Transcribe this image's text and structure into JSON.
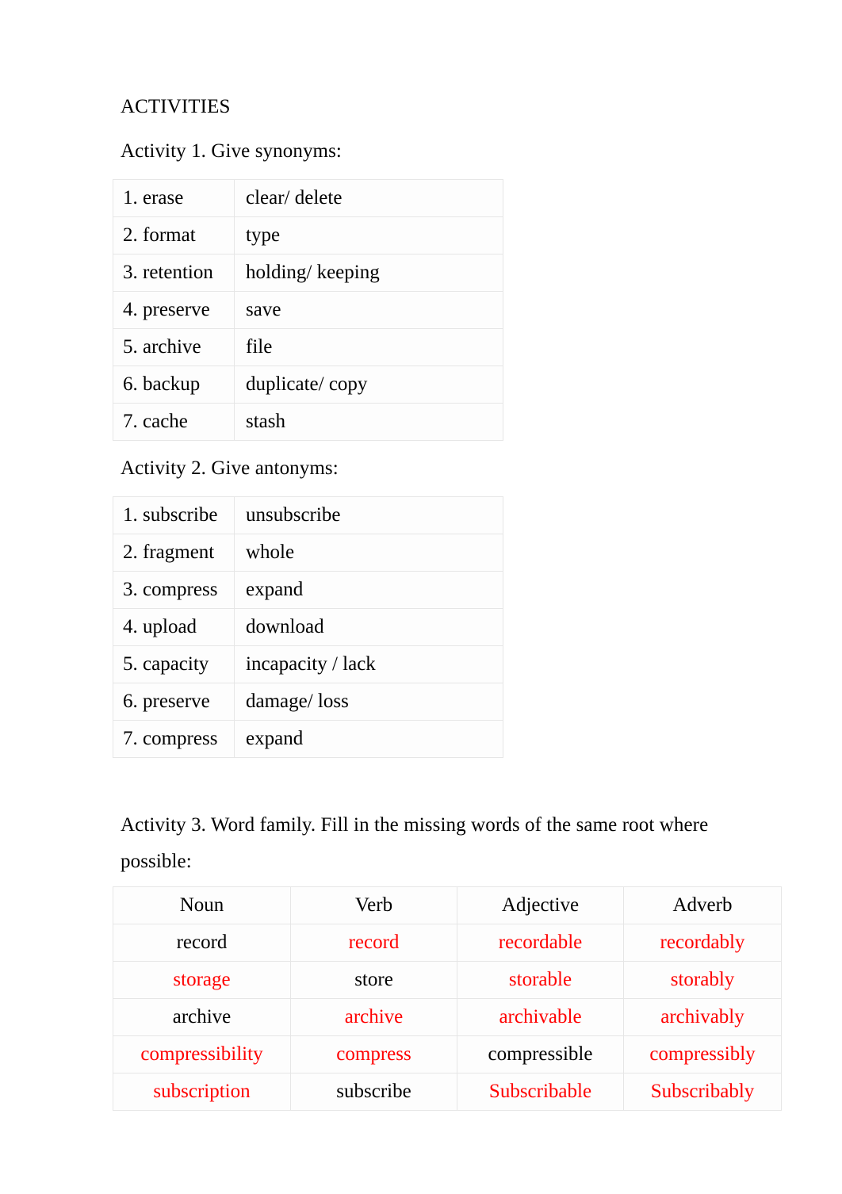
{
  "document": {
    "heading": "ACTIVITIES",
    "colors": {
      "text": "#000000",
      "filled_answer": "#ff0000",
      "table_border": "#e6e6e6",
      "page_background": "#ffffff"
    }
  },
  "activity1": {
    "label": "Activity 1. Give synonyms:",
    "rows": [
      {
        "term": "1. erase",
        "answer": "clear/ delete"
      },
      {
        "term": "2. format",
        "answer": "type"
      },
      {
        "term": "3. retention",
        "answer": "holding/ keeping"
      },
      {
        "term": "4. preserve",
        "answer": "save"
      },
      {
        "term": "5. archive",
        "answer": "file"
      },
      {
        "term": "6. backup",
        "answer": "duplicate/ copy"
      },
      {
        "term": "7. cache",
        "answer": "stash"
      }
    ]
  },
  "activity2": {
    "label": "Activity 2. Give antonyms:",
    "rows": [
      {
        "term": "1. subscribe",
        "answer": "unsubscribe"
      },
      {
        "term": "2. fragment",
        "answer": "whole"
      },
      {
        "term": "3. compress",
        "answer": "expand"
      },
      {
        "term": "4. upload",
        "answer": "download"
      },
      {
        "term": "5. capacity",
        "answer": "incapacity / lack"
      },
      {
        "term": "6. preserve",
        "answer": "damage/ loss"
      },
      {
        "term": "7. compress",
        "answer": "expand"
      }
    ]
  },
  "activity3": {
    "label": "Activity 3. Word family. Fill in the missing words of the same root where possible:",
    "headers": [
      "Noun",
      "Verb",
      "Adjective",
      "Adverb"
    ],
    "rows": [
      {
        "noun": {
          "text": "record",
          "color": "black"
        },
        "verb": {
          "text": "record",
          "color": "red"
        },
        "adjective": {
          "text": "recordable",
          "color": "red"
        },
        "adverb": {
          "text": "recordably",
          "color": "red"
        }
      },
      {
        "noun": {
          "text": "storage",
          "color": "red"
        },
        "verb": {
          "text": "store",
          "color": "black"
        },
        "adjective": {
          "text": "storable",
          "color": "red"
        },
        "adverb": {
          "text": "storably",
          "color": "red"
        }
      },
      {
        "noun": {
          "text": "archive",
          "color": "black"
        },
        "verb": {
          "text": "archive",
          "color": "red"
        },
        "adjective": {
          "text": "archivable",
          "color": "red"
        },
        "adverb": {
          "text": "archivably",
          "color": "red"
        }
      },
      {
        "noun": {
          "text": "compressibility",
          "color": "red"
        },
        "verb": {
          "text": "compress",
          "color": "red"
        },
        "adjective": {
          "text": "compressible",
          "color": "black"
        },
        "adverb": {
          "text": "compressibly",
          "color": "red"
        }
      },
      {
        "noun": {
          "text": "subscription",
          "color": "red"
        },
        "verb": {
          "text": "subscribe",
          "color": "black"
        },
        "adjective": {
          "text": "Subscribable",
          "color": "red"
        },
        "adverb": {
          "text": "Subscribably",
          "color": "red"
        }
      }
    ]
  }
}
